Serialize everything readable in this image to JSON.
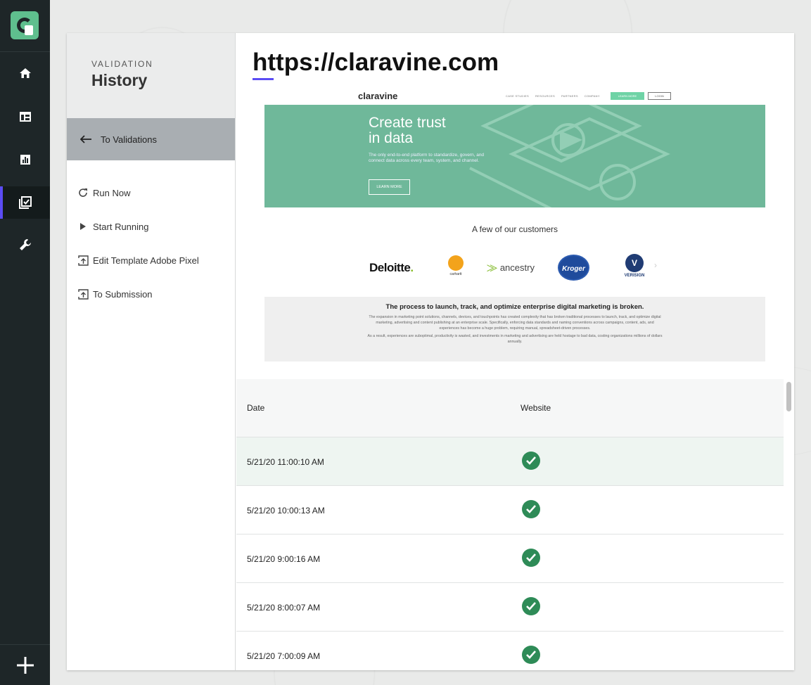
{
  "rail": {
    "items": [
      {
        "icon": "home-icon"
      },
      {
        "icon": "table-layout-icon"
      },
      {
        "icon": "bar-chart-icon"
      },
      {
        "icon": "checklist-icon",
        "active": true
      },
      {
        "icon": "wrench-icon"
      }
    ],
    "add_icon": "plus-icon"
  },
  "sidebar": {
    "kicker": "VALIDATION",
    "title": "History",
    "back_label": "To Validations",
    "menu": [
      {
        "label": "Run Now",
        "icon": "refresh-icon"
      },
      {
        "label": "Start Running",
        "icon": "play-icon"
      },
      {
        "label": "Edit Template Adobe Pixel",
        "icon": "upload-box-icon"
      },
      {
        "label": "To Submission",
        "icon": "upload-box-icon"
      }
    ]
  },
  "main": {
    "url_title": "https://claravine.com",
    "accent_color": "#5b4cf4"
  },
  "preview": {
    "logo": "claravine",
    "nav_links": [
      "CASE STUDIES",
      "RESOURCES",
      "PARTNERS",
      "COMPANY"
    ],
    "nav_primary": "LEARN MORE",
    "nav_secondary": "LOGIN",
    "hero_title_1": "Create trust",
    "hero_title_2": "in data",
    "hero_sub": "The only end-to-end platform to standardize, govern, and connect data across every team, system, and channel.",
    "hero_button": "LEARN MORE",
    "customers_heading": "A few of our customers",
    "logos": {
      "deloitte": "Deloitte",
      "deloitte_dot": ".",
      "carhartt": "carhartt",
      "ancestry": "ancestry",
      "kroger": "Kroger",
      "verisign_mark": "V",
      "verisign": "VERISIGN"
    },
    "panel_heading": "The process to launch, track, and optimize enterprise digital marketing is broken.",
    "panel_p1": "The expansion in marketing point solutions, channels, devices, and touchpoints has created complexity that has broken traditional processes to launch, track, and optimize digital marketing, advertising and content publishing at an enterprise scale. Specifically, enforcing data standards and naming conventions across campaigns, content, ads, and experiences has become a huge problem, requiring manual, spreadsheet-driven processes.",
    "panel_p2": "As a result, experiences are suboptimal, productivity is wasted, and investments in marketing and advertising are held hostage to bad data, costing organizations millions of dollars annually."
  },
  "table": {
    "columns": [
      "Date",
      "Website"
    ],
    "rows": [
      {
        "date": "5/21/20 11:00:10 AM",
        "status": "check-icon"
      },
      {
        "date": "5/21/20 10:00:13 AM",
        "status": "check-icon"
      },
      {
        "date": "5/21/20 9:00:16 AM",
        "status": "check-icon"
      },
      {
        "date": "5/21/20 8:00:07 AM",
        "status": "check-icon"
      },
      {
        "date": "5/21/20 7:00:09 AM",
        "status": "check-icon"
      }
    ],
    "check_color": "#2e8b57"
  }
}
